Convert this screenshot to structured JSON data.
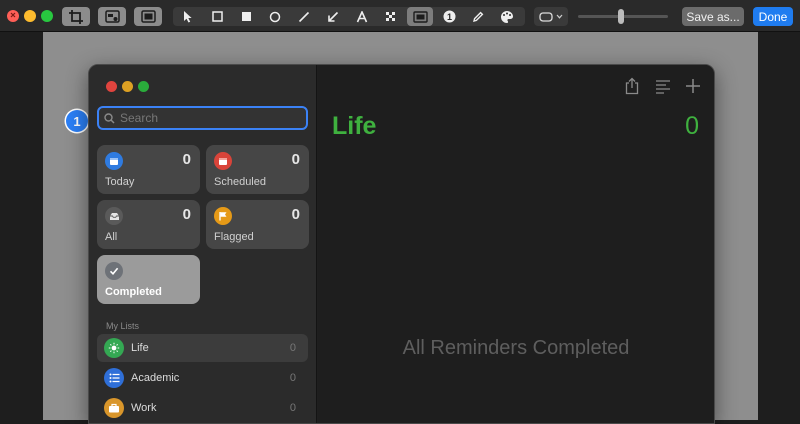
{
  "toolbar": {
    "tools": [
      "pointer-tool",
      "rectangle-outline-tool",
      "rectangle-fill-tool",
      "circle-tool",
      "line-tool",
      "arrow-tool",
      "text-tool",
      "pixelate-tool",
      "highlight-tool",
      "counter-tool",
      "pencil-tool",
      "color-tool"
    ],
    "active_tool": "highlight-tool",
    "counter_glyph": "1",
    "save_label": "Save as...",
    "done_label": "Done",
    "line_width_level": 0.48
  },
  "annotation": {
    "number": "1"
  },
  "search": {
    "placeholder": "Search"
  },
  "smart_lists": [
    {
      "label": "Today",
      "count": "0",
      "color": "#2f7be0",
      "icon": "calendar-icon"
    },
    {
      "label": "Scheduled",
      "count": "0",
      "color": "#d9443a",
      "icon": "calendar-red-icon"
    },
    {
      "label": "All",
      "count": "0",
      "color": "#5a5a5a",
      "icon": "tray-icon"
    },
    {
      "label": "Flagged",
      "count": "0",
      "color": "#e69a17",
      "icon": "flag-icon"
    },
    {
      "label": "Completed",
      "count": "",
      "color": "#6e7278",
      "icon": "checkmark-icon"
    }
  ],
  "my_lists_header": "My Lists",
  "my_lists": [
    {
      "name": "Life",
      "count": "0",
      "color": "#34a853",
      "icon": "sun-icon"
    },
    {
      "name": "Academic",
      "count": "0",
      "color": "#2f6fd8",
      "icon": "list-bullet-icon"
    },
    {
      "name": "Work",
      "count": "0",
      "color": "#d9962b",
      "icon": "briefcase-icon"
    }
  ],
  "main": {
    "title": "Life",
    "count": "0",
    "empty_message": "All Reminders Completed",
    "accent": "#3fb13f"
  }
}
